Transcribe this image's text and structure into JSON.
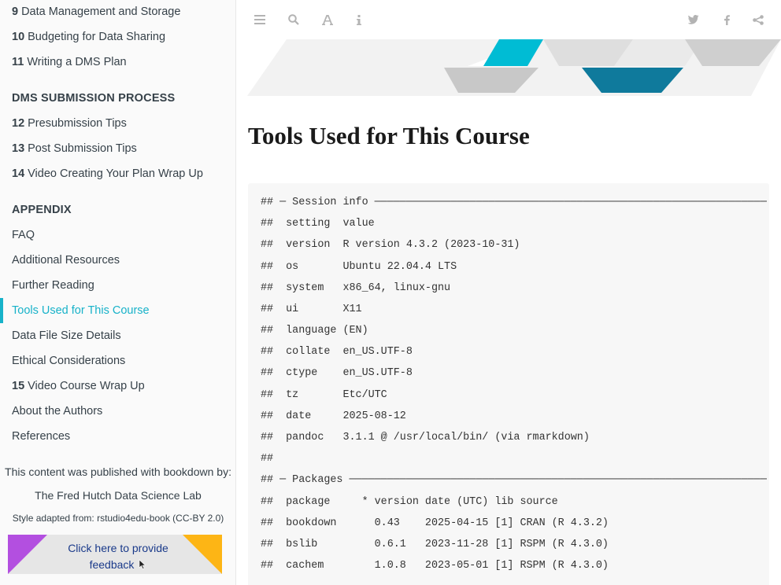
{
  "sidebar": {
    "chapters_top": [
      {
        "num": "9",
        "label": "Data Management and Storage"
      },
      {
        "num": "10",
        "label": "Budgeting for Data Sharing"
      },
      {
        "num": "11",
        "label": "Writing a DMS Plan"
      }
    ],
    "section_dms": "DMS SUBMISSION PROCESS",
    "chapters_dms": [
      {
        "num": "12",
        "label": "Presubmission Tips"
      },
      {
        "num": "13",
        "label": "Post Submission Tips"
      },
      {
        "num": "14",
        "label": "Video Creating Your Plan Wrap Up"
      }
    ],
    "section_appendix": "APPENDIX",
    "appendix_items": [
      {
        "label": "FAQ"
      },
      {
        "label": "Additional Resources"
      },
      {
        "label": "Further Reading"
      },
      {
        "label": "Tools Used for This Course"
      },
      {
        "label": "Data File Size Details"
      },
      {
        "label": "Ethical Considerations"
      }
    ],
    "chapter_15": {
      "num": "15",
      "label": "Video Course Wrap Up"
    },
    "about": "About the Authors",
    "references": "References",
    "published_with": "This content was published with bookdown by:",
    "lab_link": "The Fred Hutch Data Science Lab",
    "style_adapted": "Style adapted from: rstudio4edu-book (CC-BY 2.0)",
    "feedback_line1": "Click here to provide",
    "feedback_line2": "feedback",
    "active_color": "#17b2c9"
  },
  "toolbar": {
    "icons": [
      "menu-icon",
      "search-icon",
      "font-icon",
      "info-icon",
      "twitter-icon",
      "facebook-icon",
      "share-icon"
    ]
  },
  "main": {
    "title": "Tools Used for This Course",
    "code_lines": [
      "## ─ Session info ──────────────────────────────────────────────────────────────",
      "##  setting  value",
      "##  version  R version 4.3.2 (2023-10-31)",
      "##  os       Ubuntu 22.04.4 LTS",
      "##  system   x86_64, linux-gnu",
      "##  ui       X11",
      "##  language (EN)",
      "##  collate  en_US.UTF-8",
      "##  ctype    en_US.UTF-8",
      "##  tz       Etc/UTC",
      "##  date     2025-08-12",
      "##  pandoc   3.1.1 @ /usr/local/bin/ (via rmarkdown)",
      "##",
      "## ─ Packages ──────────────────────────────────────────────────────────────────",
      "##  package     * version date (UTC) lib source",
      "##  bookdown      0.43    2025-04-15 [1] CRAN (R 4.3.2)",
      "##  bslib         0.6.1   2023-11-28 [1] RSPM (R 4.3.0)",
      "##  cachem        1.0.8   2023-05-01 [1] RSPM (R 4.3.0)"
    ]
  }
}
